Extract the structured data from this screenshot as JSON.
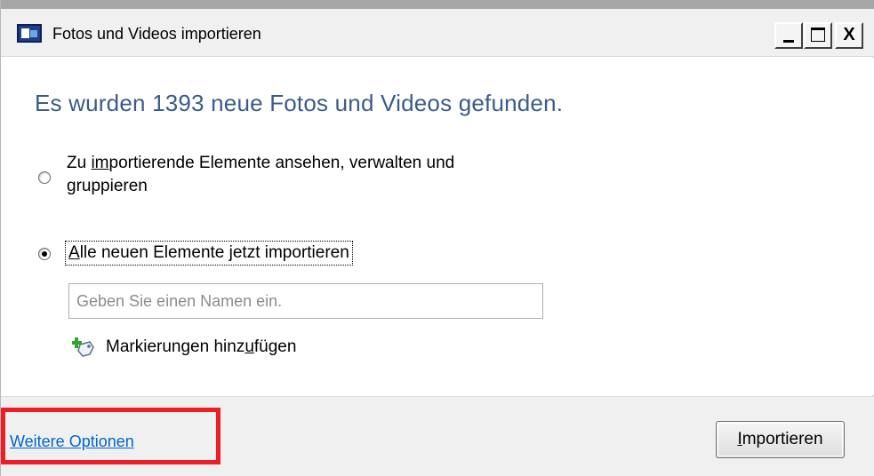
{
  "window": {
    "title": "Fotos und Videos importieren",
    "buttons": {
      "close": "X"
    }
  },
  "content": {
    "headline": "Es wurden 1393 neue Fotos und Videos gefunden.",
    "option_review": {
      "pre": "Zu ",
      "accel": "im",
      "post": "portierende Elemente ansehen, verwalten und",
      "line2": "gruppieren",
      "selected": false
    },
    "option_import_all": {
      "accel": "A",
      "post": "lle neuen Elemente jetzt importieren",
      "selected": true
    },
    "name_input": {
      "value": "",
      "placeholder": "Geben Sie einen Namen ein."
    },
    "add_tags": {
      "pre": "Markierungen hinz",
      "accel": "u",
      "post": "fügen",
      "icon": "tag-add-icon"
    }
  },
  "footer": {
    "more_options": "Weitere Optionen",
    "import_button": {
      "accel": "I",
      "post": "mportieren"
    }
  },
  "colors": {
    "headline": "#3a5c8a",
    "link": "#0066cc",
    "highlight": "#ee1c25"
  }
}
